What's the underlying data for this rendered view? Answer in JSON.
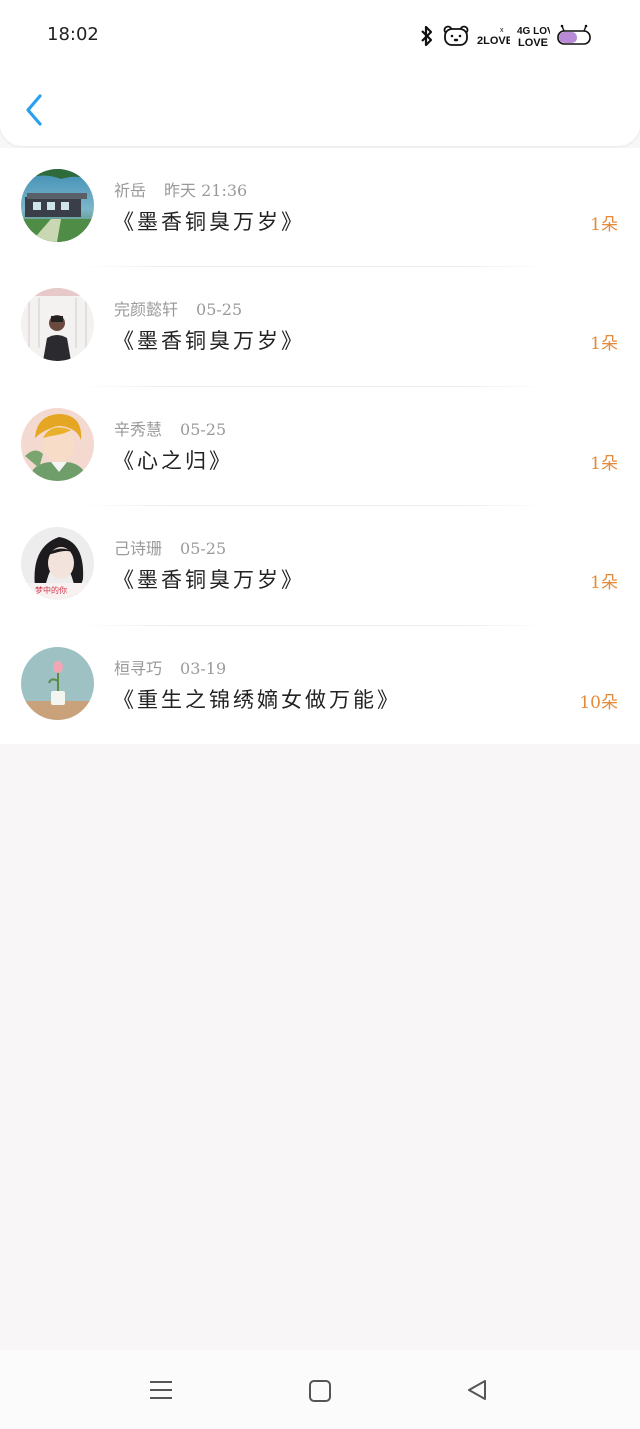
{
  "status": {
    "time": "18:02",
    "icons": [
      "bluetooth-icon",
      "bear-sticker-icon",
      "love-signal-icon",
      "love-4g-icon",
      "battery-icon"
    ],
    "signal_labels": [
      "2LOVE",
      "4G LOVE"
    ]
  },
  "nav": {
    "back_icon": "chevron-left-icon",
    "accent": "#2aa0f0"
  },
  "items": [
    {
      "name": "祈岳",
      "time": "昨天 21:36",
      "title": "《墨香铜臭万岁》",
      "count": "1朵"
    },
    {
      "name": "完颜懿轩",
      "time": "05-25",
      "title": "《墨香铜臭万岁》",
      "count": "1朵"
    },
    {
      "name": "辛秀慧",
      "time": "05-25",
      "title": "《心之归》",
      "count": "1朵"
    },
    {
      "name": "己诗珊",
      "time": "05-25",
      "title": "《墨香铜臭万岁》",
      "count": "1朵"
    },
    {
      "name": "桓寻巧",
      "time": "03-19",
      "title": "《重生之锦绣嫡女做万能》",
      "count": "10朵"
    }
  ],
  "bottom_nav": [
    "menu-icon",
    "home-square-icon",
    "back-triangle-icon"
  ],
  "colors": {
    "count": "#e48a3a",
    "meta": "#9a9a9a",
    "background": "#f8f6f7"
  }
}
